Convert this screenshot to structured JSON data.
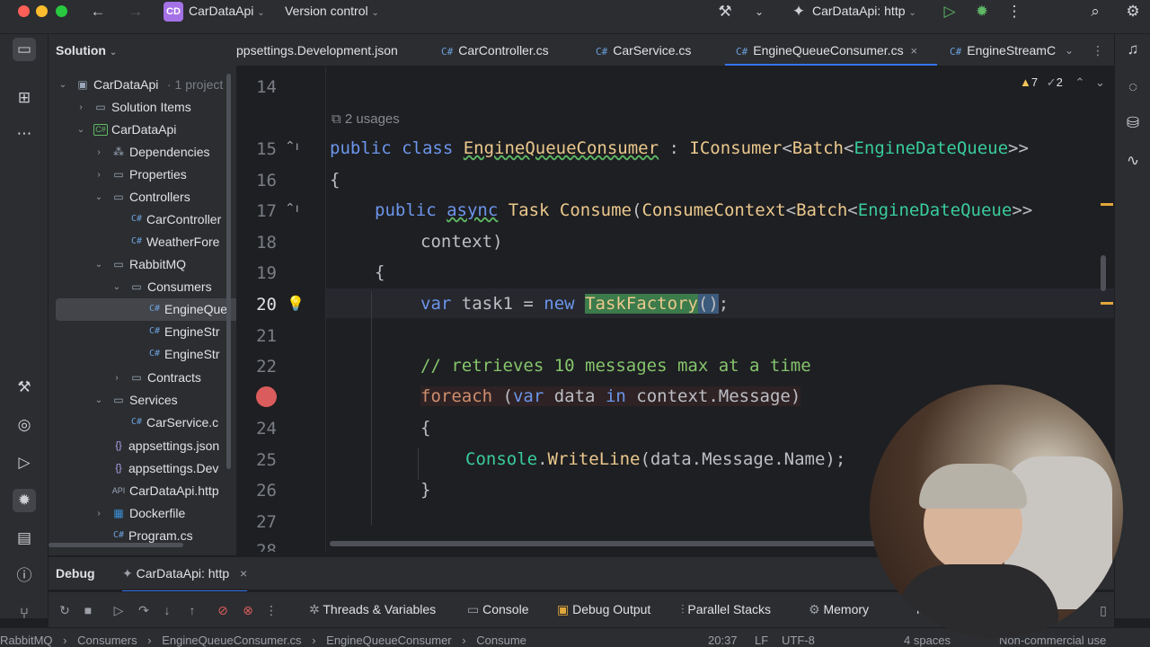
{
  "titlebar": {
    "project_badge": "CD",
    "project_name": "CarDataApi",
    "vcs": "Version control",
    "run_config": "CarDataApi: http"
  },
  "solution": {
    "header": "Solution",
    "tree": [
      {
        "label": "CarDataApi",
        "extra": "· 1 project",
        "icon": "solution-icon"
      },
      {
        "label": "Solution Items",
        "icon": "folder-icon"
      },
      {
        "label": "CarDataApi",
        "icon": "project-icon"
      },
      {
        "label": "Dependencies",
        "icon": "dependencies-icon"
      },
      {
        "label": "Properties",
        "icon": "folder-icon"
      },
      {
        "label": "Controllers",
        "icon": "folder-icon"
      },
      {
        "label": "CarController",
        "icon": "csharp-file-icon"
      },
      {
        "label": "WeatherFore",
        "icon": "csharp-file-icon"
      },
      {
        "label": "RabbitMQ",
        "icon": "folder-icon"
      },
      {
        "label": "Consumers",
        "icon": "folder-icon"
      },
      {
        "label": "EngineQue",
        "icon": "csharp-file-icon"
      },
      {
        "label": "EngineStr",
        "icon": "csharp-file-icon"
      },
      {
        "label": "EngineStr",
        "icon": "csharp-file-icon"
      },
      {
        "label": "Contracts",
        "icon": "folder-icon"
      },
      {
        "label": "Services",
        "icon": "folder-icon"
      },
      {
        "label": "CarService.c",
        "icon": "csharp-file-icon"
      },
      {
        "label": "appsettings.json",
        "icon": "json-file-icon"
      },
      {
        "label": "appsettings.Dev",
        "icon": "json-file-icon"
      },
      {
        "label": "CarDataApi.http",
        "icon": "http-file-icon"
      },
      {
        "label": "Dockerfile",
        "icon": "docker-icon"
      },
      {
        "label": "Program.cs",
        "icon": "csharp-file-icon"
      }
    ]
  },
  "tabs": [
    {
      "label": "ppsettings.Development.json"
    },
    {
      "label": "CarController.cs"
    },
    {
      "label": "CarService.cs"
    },
    {
      "label": "EngineQueueConsumer.cs"
    },
    {
      "label": "EngineStreamC"
    }
  ],
  "editor": {
    "inspection_warnings": "7",
    "inspection_hints": "2",
    "usages": "2 usages",
    "line_numbers": [
      "14",
      "15",
      "16",
      "17",
      "18",
      "19",
      "20",
      "21",
      "22",
      "23",
      "24",
      "25",
      "26",
      "27",
      "28"
    ],
    "lines": {
      "l15": {
        "kw": "public class ",
        "cls": "EngineQueueConsumer",
        "p1": " : ",
        "iface": "IConsumer",
        "p2": "<",
        "c2": "Batch",
        "p3": "<",
        "c3": "EngineDateQueue",
        "p4": ">>"
      },
      "l16": "{",
      "l17": {
        "kw": "public ",
        "kw2": "async",
        "t": " Task ",
        "meth": "Consume",
        "p1": "(",
        "c1": "ConsumeContext",
        "p2": "<",
        "c2": "Batch",
        "p3": "<",
        "c3": "EngineDateQueue",
        "p4": ">>"
      },
      "l18": "context)",
      "l19": "{",
      "l20": {
        "kw": "var",
        "id": " task1 = ",
        "kw3": "new",
        "cls": "TaskFactory",
        "p": "()",
        "end": ";"
      },
      "l22": "// retrieves 10 messages max at a time",
      "l23": {
        "kw2": "foreach",
        "p1": " (",
        "kw": "var",
        "id": " data ",
        "kw3": "in",
        "rest": " context.Message)"
      },
      "l24": "{",
      "l25": {
        "cls": "Console",
        "p1": ".",
        "meth": "WriteLine",
        "rest": "(data.Message.Name);"
      },
      "l26": "}"
    }
  },
  "debug": {
    "title": "Debug",
    "session": "CarDataApi: http",
    "tabs": [
      "Threads & Variables",
      "Console",
      "Debug Output",
      "Parallel Stacks",
      "Memory",
      "M"
    ]
  },
  "status": {
    "breadcrumbs": [
      "RabbitMQ",
      "Consumers",
      "EngineQueueConsumer.cs",
      "EngineQueueConsumer",
      "Consume"
    ],
    "position": "20:37",
    "line_ending": "LF",
    "encoding": "UTF-8",
    "indent": "4 spaces",
    "license": "Non-commercial use"
  },
  "colors": {
    "accent": "#3574f0",
    "breakpoint": "#db5c5c",
    "highlight": "#3c7b4b"
  }
}
